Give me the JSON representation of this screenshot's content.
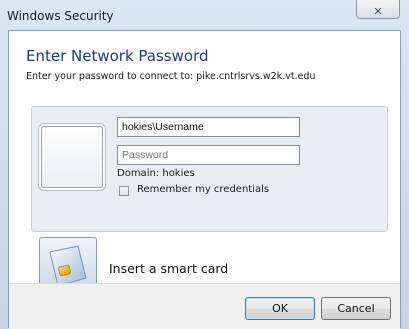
{
  "window": {
    "title": "Windows Security",
    "close_glyph": "✕"
  },
  "dialog": {
    "heading": "Enter Network Password",
    "subheading": "Enter your password to connect to: pike.cntrlsrvs.w2k.vt.edu"
  },
  "credentials": {
    "username_value": "hokies\\Username",
    "password_placeholder": "Password",
    "domain_text": "Domain: hokies",
    "remember_label": "Remember my credentials",
    "remember_checked": false
  },
  "smartcard": {
    "label": "Insert a smart card",
    "icon": "smart-card-icon"
  },
  "buttons": {
    "ok_label": "OK",
    "cancel_label": "Cancel"
  },
  "colors": {
    "heading": "#1e3a8a",
    "ok_border": "#3c7fb1"
  }
}
